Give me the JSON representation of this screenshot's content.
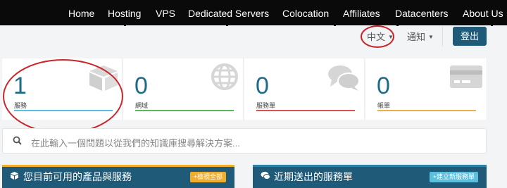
{
  "nav": {
    "items": [
      "Home",
      "Hosting",
      "VPS",
      "Dedicated Servers",
      "Colocation",
      "Affiliates",
      "Datacenters",
      "About Us"
    ]
  },
  "header": {
    "language": "中文",
    "notifications": "通知",
    "logout": "登出"
  },
  "tiles": [
    {
      "count": "1",
      "label": "服務",
      "icon": "cube-icon",
      "color": "#5bc0de"
    },
    {
      "count": "0",
      "label": "網域",
      "icon": "globe-icon",
      "color": "#5cb85c"
    },
    {
      "count": "0",
      "label": "服務單",
      "icon": "comments-icon",
      "color": "#d9534f"
    },
    {
      "count": "0",
      "label": "帳單",
      "icon": "credit-card-icon",
      "color": "#f0ad4e"
    }
  ],
  "search": {
    "placeholder": "在此輸入一個問題以從我們的知識庫搜尋解決方案..."
  },
  "panels": {
    "services": {
      "title": "您目前可用的產品與服務",
      "button": "+檢視全部"
    },
    "tickets": {
      "title": "近期送出的服務單",
      "button": "+建立新服務單"
    }
  },
  "colors": {
    "nav_bg": "#0a0a0a",
    "primary": "#1f5a78",
    "number": "#1d6b86",
    "annotation": "#c8262b"
  }
}
